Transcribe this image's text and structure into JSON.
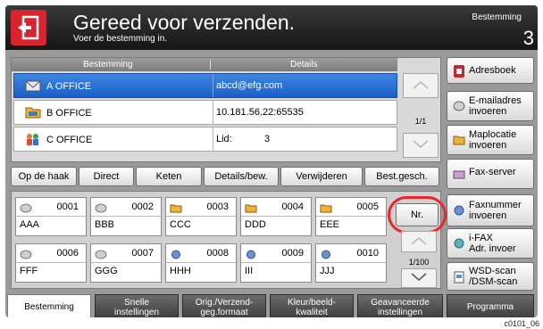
{
  "header": {
    "title": "Gereed voor verzenden.",
    "subtitle": "Voer de bestemming in.",
    "destination_label": "Bestemming",
    "destination_count": "3"
  },
  "table": {
    "col_destination": "Bestemming",
    "col_details": "Details",
    "rows": [
      {
        "name": "A OFFICE",
        "detail": "abcd@efg.com",
        "detail2": "",
        "icon": "email-icon",
        "selected": true
      },
      {
        "name": "B OFFICE",
        "detail": "10.181.56.22:65535",
        "detail2": "",
        "icon": "folder-icon",
        "selected": false
      },
      {
        "name": "C OFFICE",
        "detail": "Lid:",
        "detail2": "3",
        "icon": "group-icon",
        "selected": false
      }
    ],
    "page": "1/1"
  },
  "actions": {
    "on_hook": "Op de haak",
    "direct": "Direct",
    "chain": "Keten",
    "details_edit": "Details/bew.",
    "delete": "Verwijderen",
    "recent": "Best.gesch."
  },
  "grid": {
    "cells": [
      {
        "num": "0001",
        "label": "AAA"
      },
      {
        "num": "0002",
        "label": "BBB"
      },
      {
        "num": "0003",
        "label": "CCC"
      },
      {
        "num": "0004",
        "label": "DDD"
      },
      {
        "num": "0005",
        "label": "EEE"
      },
      {
        "num": "0006",
        "label": "FFF"
      },
      {
        "num": "0007",
        "label": "GGG"
      },
      {
        "num": "0008",
        "label": "HHH"
      },
      {
        "num": "0009",
        "label": "III"
      },
      {
        "num": "0010",
        "label": "JJJ"
      }
    ],
    "nr_label": "Nr.",
    "page": "1/100"
  },
  "side": {
    "address_book": "Adresboek",
    "email_entry_1": "E-mailadres",
    "email_entry_2": "invoeren",
    "folder_entry_1": "Maplocatie",
    "folder_entry_2": "invoeren",
    "fax_server": "Fax-server",
    "fax_number_1": "Faxnummer",
    "fax_number_2": "invoeren",
    "ifax_1": "i-FAX",
    "ifax_2": "Adr. invoer",
    "wsd_1": "WSD-scan",
    "wsd_2": "/DSM-scan"
  },
  "tabs": [
    {
      "l1": "Bestemming",
      "l2": ""
    },
    {
      "l1": "Snelle",
      "l2": "instellingen"
    },
    {
      "l1": "Orig./Verzend-",
      "l2": "geg.formaat"
    },
    {
      "l1": "Kleur/beeld-",
      "l2": "kwaliteit"
    },
    {
      "l1": "Geavanceerde",
      "l2": "instellingen"
    },
    {
      "l1": "Programma",
      "l2": ""
    }
  ],
  "caption": "c0101_06",
  "colors": {
    "accent_red": "#e8262d",
    "selection_blue": "#1a5fc8"
  }
}
